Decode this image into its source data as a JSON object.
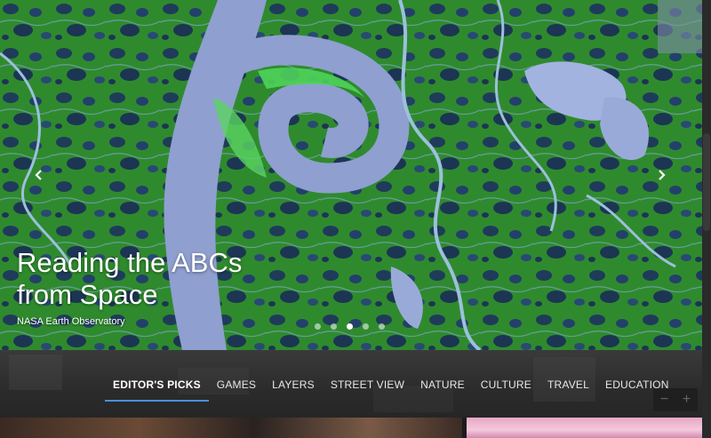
{
  "hero": {
    "title_line1": "Reading the ABCs",
    "title_line2": "from Space",
    "credit": "NASA Earth Observatory",
    "slides_count": 5,
    "active_slide": 3,
    "prev_icon": "chevron-left-icon",
    "next_icon": "chevron-right-icon"
  },
  "tabs": [
    {
      "label": "EDITOR'S PICKS",
      "active": true
    },
    {
      "label": "GAMES"
    },
    {
      "label": "LAYERS"
    },
    {
      "label": "STREET VIEW"
    },
    {
      "label": "NATURE"
    },
    {
      "label": "CULTURE"
    },
    {
      "label": "TRAVEL"
    },
    {
      "label": "EDUCATION"
    }
  ],
  "zoom": {
    "minus": "−",
    "plus": "+"
  },
  "colors": {
    "accent": "#4a90e2",
    "tabbar_bg": "#2b2b2b"
  }
}
